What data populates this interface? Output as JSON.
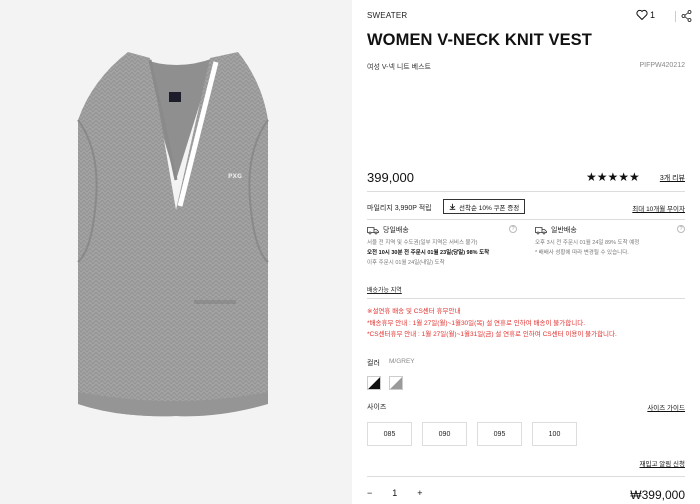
{
  "product": {
    "category": "SWEATER",
    "likes": "1",
    "title": "WOMEN V-NECK KNIT VEST",
    "subtitle": "여성 V-넥 니트 베스트",
    "code": "PIFPW420212",
    "price": "399,000",
    "rating": "★★★★★",
    "reviews": "3개 리뷰"
  },
  "benefits": {
    "mileage": "마일리지 3,990P 적립",
    "coupon": "선착순 10% 쿠폰 증정",
    "max_benefit": "최대 10개월 무이자"
  },
  "shipping": {
    "today": {
      "title": "당일배송",
      "line1": "서울 전 지역 및 수도권(일부 지역은 서비스 불가)",
      "line2": "오전 10시 30분 전 주문시 01월 23일(당일) 98% 도착",
      "line3": "이후 주문시 01월 24일(내일) 도착"
    },
    "general": {
      "title": "일반배송",
      "line1": "오후 3시 전 주문시 01월 24일 89% 도착 예정",
      "line2": "* 배배사 성황에 따라 변경될 수 있습니다."
    },
    "areas_link": "배송가능 지역"
  },
  "notice": [
    "※설연휴 배송 및 CS센터 휴무안내",
    "*배송휴무 안내 : 1월 27일(월)~1월30일(목) 설 연휴로 인하여 배송이 불가합니다.",
    "*CS센터휴무 안내 : 1월 27일(월)~1월31일(금) 설 연휴로 인하여 CS센터 이용이 불가합니다."
  ],
  "options": {
    "color_label": "컬러",
    "color_value": "M/GREY",
    "size_label": "사이즈",
    "size_guide": "사이즈 가이드",
    "sizes": [
      "085",
      "090",
      "095",
      "100"
    ],
    "restock": "재입고 알림 신청"
  },
  "order": {
    "minus": "−",
    "qty": "1",
    "plus": "+",
    "total": "₩399,000"
  },
  "colors": {
    "accent_red": "#e0322f",
    "swatch_black": "#111111",
    "swatch_grey": "#9a9a9a"
  }
}
